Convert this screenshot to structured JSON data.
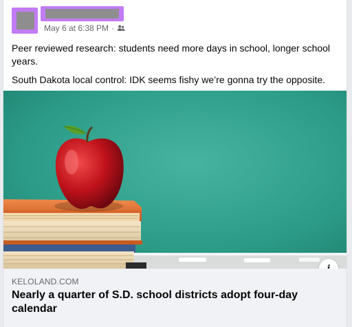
{
  "post": {
    "timestamp": "May 6 at 6:38 PM",
    "separator": "·",
    "audience_icon": "friends-icon",
    "paragraphs": [
      "Peer reviewed research: students need more days in school, longer school years.",
      "South Dakota local control: IDK seems fishy we’re gonna try the opposite."
    ]
  },
  "link": {
    "domain": "KELOLAND.COM",
    "headline": "Nearly a quarter of S.D. school districts adopt four-day calendar",
    "info_icon": "info-icon",
    "info_glyph": "i"
  },
  "colors": {
    "redaction": "#c17cf5",
    "redaction_fill": "#8e8e8e",
    "chalkboard": "#2c9c88",
    "apple": "#c0121b"
  }
}
